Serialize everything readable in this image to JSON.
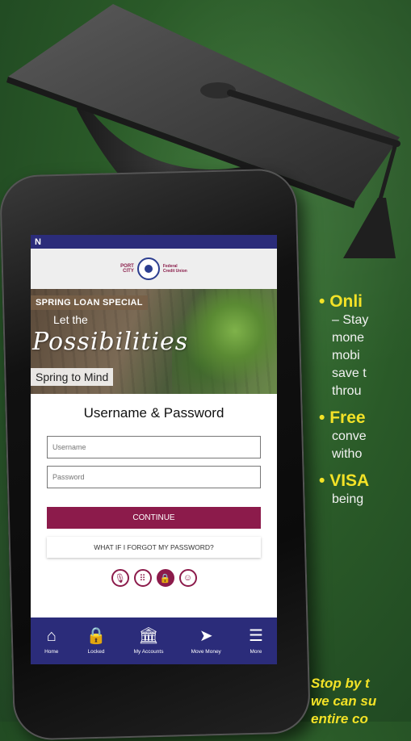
{
  "app": {
    "status_glyph": "N",
    "logo": {
      "line1": "PORT",
      "line2": "CITY",
      "sub1": "Federal",
      "sub2": "Credit Union"
    }
  },
  "banner": {
    "tag": "SPRING LOAN SPECIAL",
    "line1": "Let the",
    "script": "Possibilities",
    "line2": "Spring to Mind"
  },
  "login": {
    "title": "Username & Password",
    "username_placeholder": "Username",
    "password_placeholder": "Password",
    "continue_label": "CONTINUE",
    "forgot_label": "WHAT IF I FORGOT MY PASSWORD?",
    "auth_icons": [
      "microphone-icon",
      "keypad-icon",
      "lock-icon",
      "face-icon"
    ]
  },
  "tabs": [
    {
      "label": "Home",
      "icon": "home-icon",
      "glyph": "⌂"
    },
    {
      "label": "Locked",
      "icon": "lock-icon",
      "glyph": "🔒"
    },
    {
      "label": "My Accounts",
      "icon": "bank-icon",
      "glyph": "🏛"
    },
    {
      "label": "Move Money",
      "icon": "send-icon",
      "glyph": "➤"
    },
    {
      "label": "More",
      "icon": "menu-icon",
      "glyph": "☰"
    }
  ],
  "aside": {
    "bullets": [
      {
        "title": "Onli",
        "lines": [
          "– Stay",
          "mone",
          "mobi",
          "save t",
          "throu"
        ]
      },
      {
        "title": "Free",
        "lines": [
          "conve",
          "witho"
        ]
      },
      {
        "title": "VISA",
        "lines": [
          "being"
        ]
      }
    ],
    "footer": [
      "Stop by t",
      "we can su",
      "entire co"
    ]
  },
  "colors": {
    "brand": "#8c1b4b",
    "nav": "#2b2c7a",
    "accent_text": "#f3e227",
    "board": "#2a5a28"
  }
}
